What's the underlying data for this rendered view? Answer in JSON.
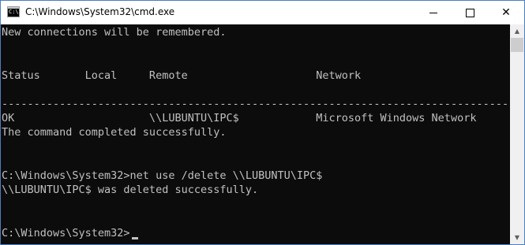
{
  "window": {
    "title": "C:\\Windows\\System32\\cmd.exe",
    "icon_name": "cmd-icon",
    "icon_text": "C:\\."
  },
  "controls": {
    "minimize_icon": "minimize-icon",
    "maximize_icon": "maximize-icon",
    "close_icon": "close-icon",
    "close_glyph": "✕"
  },
  "scrollbar": {
    "up_glyph": "▲",
    "down_glyph": "▼"
  },
  "console": {
    "text_color": "#c0c0c0",
    "background": "#0c0c0c",
    "lines": [
      "New connections will be remembered.",
      "",
      "",
      "Status       Local     Remote                    Network",
      "",
      "-------------------------------------------------------------------------------",
      "OK                     \\\\LUBUNTU\\IPC$            Microsoft Windows Network",
      "The command completed successfully.",
      "",
      "",
      "C:\\Windows\\System32>net use /delete \\\\LUBUNTU\\IPC$",
      "\\\\LUBUNTU\\IPC$ was deleted successfully.",
      "",
      "",
      "C:\\Windows\\System32>"
    ]
  }
}
